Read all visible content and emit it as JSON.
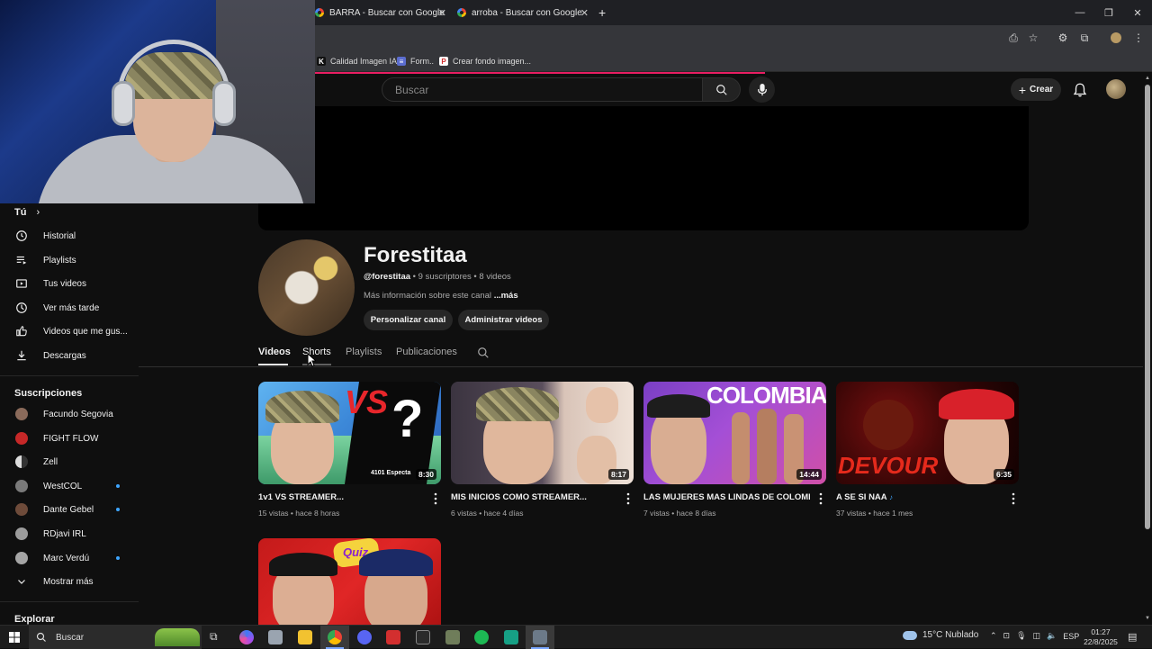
{
  "browser": {
    "tabs": [
      {
        "title": "BARRA - Buscar con Google"
      },
      {
        "title": "arroba - Buscar con Google"
      }
    ],
    "new_tab": "+",
    "bookmarks": [
      {
        "label": "Calidad Imagen IA",
        "icon": "K"
      },
      {
        "label": "Form..",
        "icon": "≡"
      },
      {
        "label": "Crear fondo imagen...",
        "icon": "P"
      }
    ]
  },
  "youtube": {
    "search_placeholder": "Buscar",
    "create_label": "Crear",
    "sidebar": {
      "you_header": "Tú",
      "you_items": [
        {
          "label": "Historial",
          "icon": "history-icon"
        },
        {
          "label": "Playlists",
          "icon": "playlist-icon"
        },
        {
          "label": "Tus videos",
          "icon": "your-videos-icon"
        },
        {
          "label": "Ver más tarde",
          "icon": "watch-later-icon"
        },
        {
          "label": "Videos que me gus...",
          "icon": "liked-videos-icon"
        },
        {
          "label": "Descargas",
          "icon": "downloads-icon"
        }
      ],
      "subs_header": "Suscripciones",
      "subscriptions": [
        {
          "label": "Facundo Segovia",
          "color": "#8a6a5a",
          "dot": false
        },
        {
          "label": "FIGHT FLOW",
          "color": "#c62828",
          "dot": false
        },
        {
          "label": "Zell",
          "color": "#dddddd",
          "dot": false
        },
        {
          "label": "WestCOL",
          "color": "#7a7a7a",
          "dot": true
        },
        {
          "label": "Dante Gebel",
          "color": "#6e4b3a",
          "dot": true
        },
        {
          "label": "RDjavi IRL",
          "color": "#9c9c9c",
          "dot": false
        },
        {
          "label": "Marc Verdú",
          "color": "#a5a5a5",
          "dot": true
        }
      ],
      "show_more": "Mostrar más",
      "explore_header": "Explorar"
    },
    "channel": {
      "name": "Forestitaa",
      "handle": "@forestitaa",
      "subscribers": "9 suscriptores",
      "video_count": "8 videos",
      "separator": " • ",
      "more_info": "Más información sobre este canal",
      "more_link": "...más",
      "customize_button": "Personalizar canal",
      "manage_button": "Administrar videos",
      "tabs": [
        {
          "label": "Videos",
          "active": true
        },
        {
          "label": "Shorts",
          "active": false
        },
        {
          "label": "Playlists",
          "active": false
        },
        {
          "label": "Publicaciones",
          "active": false
        }
      ]
    },
    "videos": [
      {
        "title": "1v1 VS STREAMER...",
        "views": "15 vistas",
        "age": "hace 8 horas",
        "duration": "8:30",
        "overlay_text": "VS",
        "extra_text": "4101 Especta"
      },
      {
        "title": "MIS INICIOS COMO STREAMER...",
        "views": "6 vistas",
        "age": "hace 4 días",
        "duration": "8:17",
        "overlay_text": "",
        "extra_text": ""
      },
      {
        "title": "LAS MUJERES MAS LINDAS DE COLOMBIA",
        "views": "7 vistas",
        "age": "hace 8 días",
        "duration": "14:44",
        "overlay_text": "COLOMBIA",
        "extra_text": ""
      },
      {
        "title": "A SE SI NAA",
        "views": "37 vistas",
        "age": "hace 1 mes",
        "duration": "6:35",
        "overlay_text": "DEVOUR",
        "extra_text": ""
      },
      {
        "title": "",
        "views": "",
        "age": "",
        "duration": "",
        "overlay_text": "Quiz",
        "extra_text": ""
      }
    ]
  },
  "taskbar": {
    "search_label": "Buscar",
    "weather": "15°C  Nublado",
    "language": "ESP",
    "time": "01:27",
    "date": "22/8/2025"
  },
  "colors": {
    "accent_blue": "#3ea6ff",
    "loading_bar": "#e91e63",
    "background": "#0f0f0f"
  }
}
